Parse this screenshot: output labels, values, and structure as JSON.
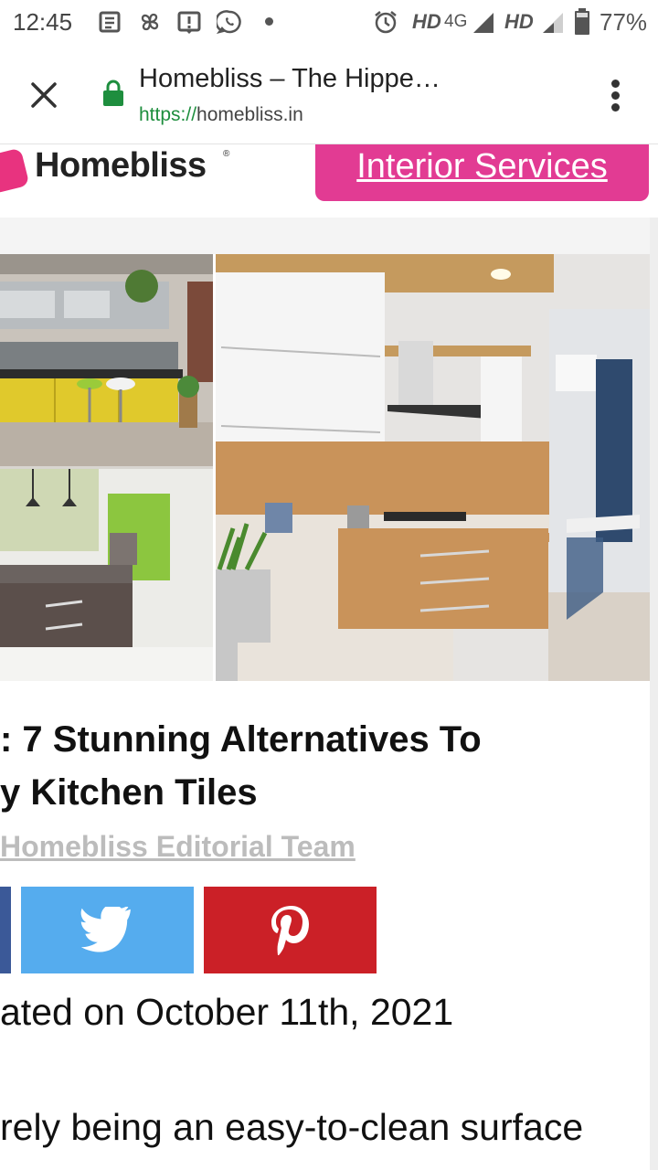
{
  "status_bar": {
    "time": "12:45",
    "hd1": "HD",
    "network": "4G",
    "hd2": "HD",
    "battery": "77%",
    "icons": [
      "news-icon",
      "pinwheel-icon",
      "alert-icon",
      "whatsapp-icon",
      "alarm-icon",
      "signal-icon",
      "battery-icon"
    ]
  },
  "browser": {
    "title": "Homebliss – The Hippe…",
    "url_scheme": "https://",
    "url_host": "homebliss.in",
    "icons": [
      "close-icon",
      "lock-icon",
      "overflow-menu-icon"
    ]
  },
  "site": {
    "logo_text": "Homebliss",
    "logo_mark": "®",
    "cta_label": "Interior Services",
    "brand_color": "#e23b93"
  },
  "article": {
    "title_line1": ": 7 Stunning Alternatives To",
    "title_line2": "y Kitchen Tiles",
    "author": "Homebliss Editorial Team",
    "updated": "ated on October 11th, 2021",
    "body_start": "rely being an easy-to-clean surface"
  },
  "share": {
    "icons": [
      "facebook-icon",
      "twitter-icon",
      "pinterest-icon"
    ],
    "colors": {
      "facebook": "#3b5998",
      "twitter": "#55acee",
      "pinterest": "#cb2027"
    }
  }
}
